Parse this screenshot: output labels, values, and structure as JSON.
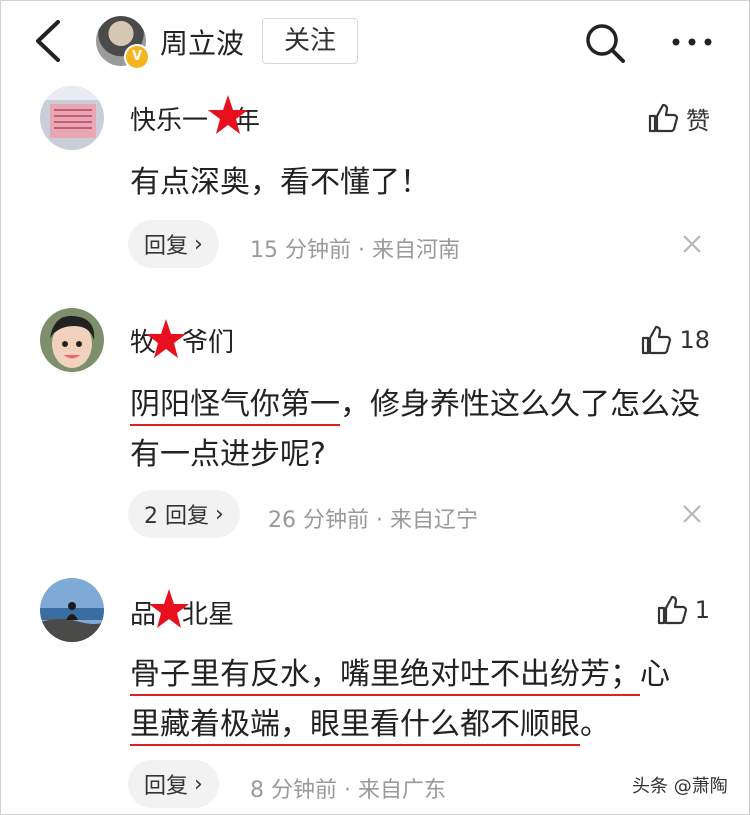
{
  "header": {
    "username": "周立波",
    "follow_label": "关注",
    "verified_badge": "V"
  },
  "comments": [
    {
      "name": "快乐一",
      "name_suffix": "年",
      "like_label": "赞",
      "text": "有点深奥，看不懂了！",
      "reply_label": "回复",
      "time": "15 分钟前",
      "location": "来自河南"
    },
    {
      "name_prefix": "牧",
      "name": "爷们",
      "like_label": "18",
      "text_underlined": "阴阳怪气你第一",
      "text_rest": "，修身养性这么久了怎么没有一点进步呢?",
      "reply_label": "2 回复",
      "time": "26 分钟前",
      "location": "来自辽宁"
    },
    {
      "name_prefix": "品",
      "name": "北星",
      "like_label": "1",
      "text_line1": "骨子里有反水，嘴里绝对吐不出纷芳；",
      "text_line1_end": "心",
      "text_line2": "里藏着极端，眼里看什么都不顺眼",
      "text_line2_end": "。",
      "reply_label": "回复",
      "time": "8 分钟前",
      "location": "来自广东"
    }
  ],
  "separator": "·",
  "watermark": "头条 @萧陶",
  "colors": {
    "underline": "#e02020",
    "star": "#e8101e",
    "badge": "#f3b51b"
  }
}
